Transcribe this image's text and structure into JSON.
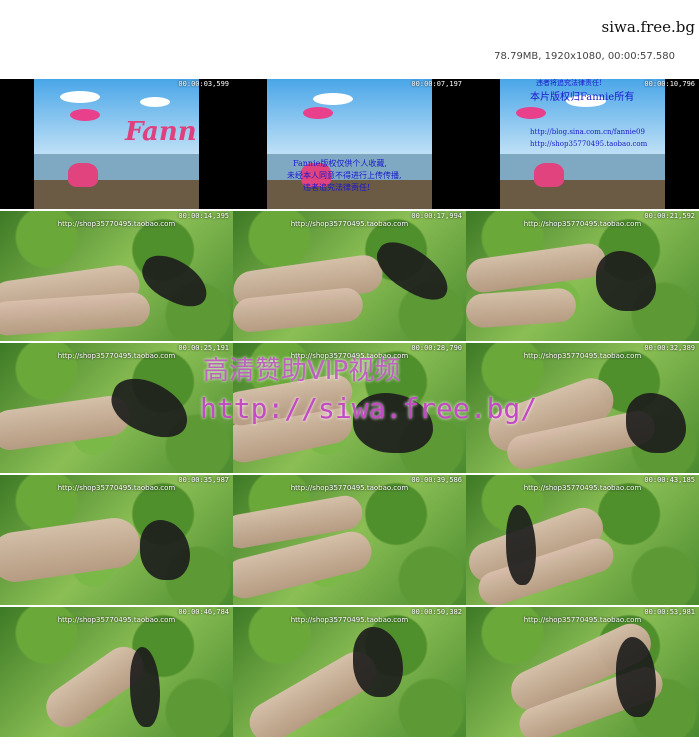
{
  "header": {
    "site": "siwa.free.bg",
    "meta": "78.79MB, 1920x1080, 00:00:57.580"
  },
  "watermark": "http://shop35770495.taobao.com",
  "row1": {
    "timestamps": [
      "00:00:03,599",
      "00:00:07,197",
      "00:00:10,796"
    ],
    "logo": "Fann",
    "thumb2_lines": [
      "Fannie版权仅供个人收藏,",
      "未经本人同意不得进行上传传播,",
      "违者追究法律责任!"
    ],
    "thumb3_lines": [
      "违者将追究法律责任!",
      "本片版权归Fannie所有",
      "http://blog.sina.com.cn/fannie09",
      "http://shop35770495.taobao.com"
    ]
  },
  "timestamps": [
    "00:00:14,395",
    "00:00:17,994",
    "00:00:21,592",
    "00:00:25,191",
    "00:00:28,790",
    "00:00:32,389",
    "00:00:35,987",
    "00:00:39,586",
    "00:00:43,185",
    "00:00:46,784",
    "00:00:50,382",
    "00:00:53,981"
  ],
  "overlay": {
    "line1": "高清赞助VIP视频",
    "line2": "http://siwa.free.bg/"
  }
}
